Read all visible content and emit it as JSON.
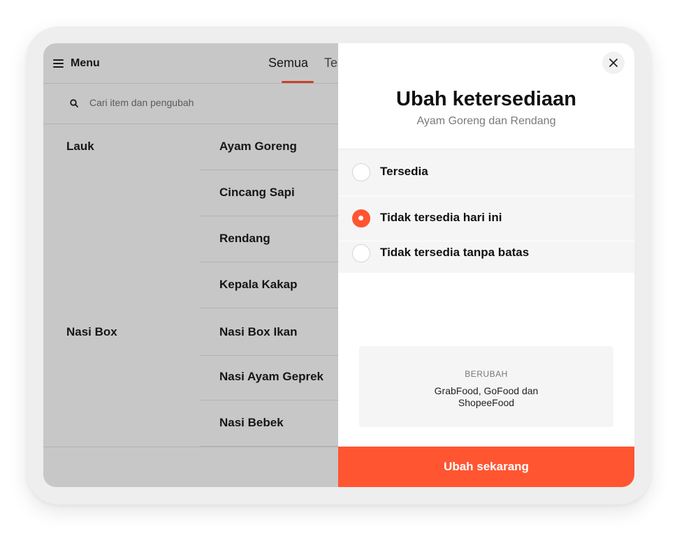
{
  "header": {
    "menu_label": "Menu",
    "tabs": [
      {
        "label": "Semua"
      },
      {
        "label": "Te"
      }
    ]
  },
  "search": {
    "placeholder": "Cari item dan pengubah"
  },
  "categories": [
    {
      "label": "Lauk"
    },
    {
      "label": "Nasi Box"
    }
  ],
  "items": [
    {
      "label": "Ayam Goreng"
    },
    {
      "label": "Cincang Sapi"
    },
    {
      "label": "Rendang"
    },
    {
      "label": "Kepala Kakap"
    },
    {
      "label": "Nasi Box Ikan"
    },
    {
      "label": "Nasi Ayam Geprek"
    },
    {
      "label": "Nasi Bebek"
    }
  ],
  "modal": {
    "title": "Ubah ketersediaan",
    "subtitle": "Ayam Goreng dan Rendang",
    "options": [
      {
        "label": "Tersedia",
        "selected": false
      },
      {
        "label": "Tidak tersedia hari ini",
        "selected": true
      },
      {
        "label": "Tidak tersedia tanpa batas",
        "selected": false
      }
    ],
    "info_label": "BERUBAH",
    "info_value": "GrabFood, GoFood dan ShopeeFood",
    "cta_label": "Ubah sekarang"
  },
  "colors": {
    "accent": "#ff5531",
    "overlay": "rgba(0,0,0,0.22)"
  },
  "icons": [
    "hamburger-icon",
    "search-icon",
    "close-icon",
    "radio-icon"
  ]
}
